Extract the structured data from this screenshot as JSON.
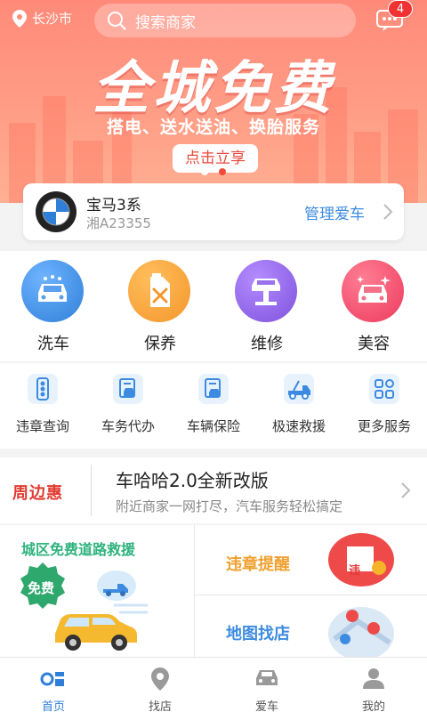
{
  "header": {
    "city": "长沙市",
    "search_placeholder": "搜索商家",
    "message_badge": "4"
  },
  "banner": {
    "headline": "全城免费",
    "subline": "搭电、送水送油、换胎服务",
    "cta": "点击立享",
    "page_count": 2,
    "active_page": 2
  },
  "car": {
    "brand_icon": "bmw-logo",
    "name": "宝马3系",
    "plate": "湘A23355",
    "manage_label": "管理爱车"
  },
  "main_services": [
    {
      "label": "洗车",
      "icon": "car-wash-icon",
      "color": "#3d8be0"
    },
    {
      "label": "保养",
      "icon": "maintenance-icon",
      "color": "#f5962b"
    },
    {
      "label": "维修",
      "icon": "repair-lift-icon",
      "color": "#8a5fe0"
    },
    {
      "label": "美容",
      "icon": "car-beauty-icon",
      "color": "#f24a6a"
    }
  ],
  "sub_services": [
    {
      "label": "违章查询",
      "icon": "traffic-light-icon"
    },
    {
      "label": "车务代办",
      "icon": "car-affairs-icon"
    },
    {
      "label": "车辆保险",
      "icon": "insurance-icon"
    },
    {
      "label": "极速救援",
      "icon": "tow-truck-icon"
    },
    {
      "label": "更多服务",
      "icon": "more-grid-icon"
    }
  ],
  "news": {
    "brand": "周边惠",
    "title": "车哈哈2.0全新改版",
    "desc": "附近商家一网打尽，汽车服务轻松搞定"
  },
  "promos": {
    "left_title": "城区免费道路救援",
    "left_badge": "免费",
    "right_top": "违章提醒",
    "right_top_icon_text": "违",
    "right_bottom": "地图找店"
  },
  "tabs": [
    {
      "label": "首页",
      "icon": "home-icon",
      "active": true
    },
    {
      "label": "找店",
      "icon": "location-pin-icon",
      "active": false
    },
    {
      "label": "爱车",
      "icon": "car-icon",
      "active": false
    },
    {
      "label": "我的",
      "icon": "user-icon",
      "active": false
    }
  ],
  "colors": {
    "accent": "#3d8be0",
    "banner": "#ff9380",
    "badge": "#f03232"
  }
}
